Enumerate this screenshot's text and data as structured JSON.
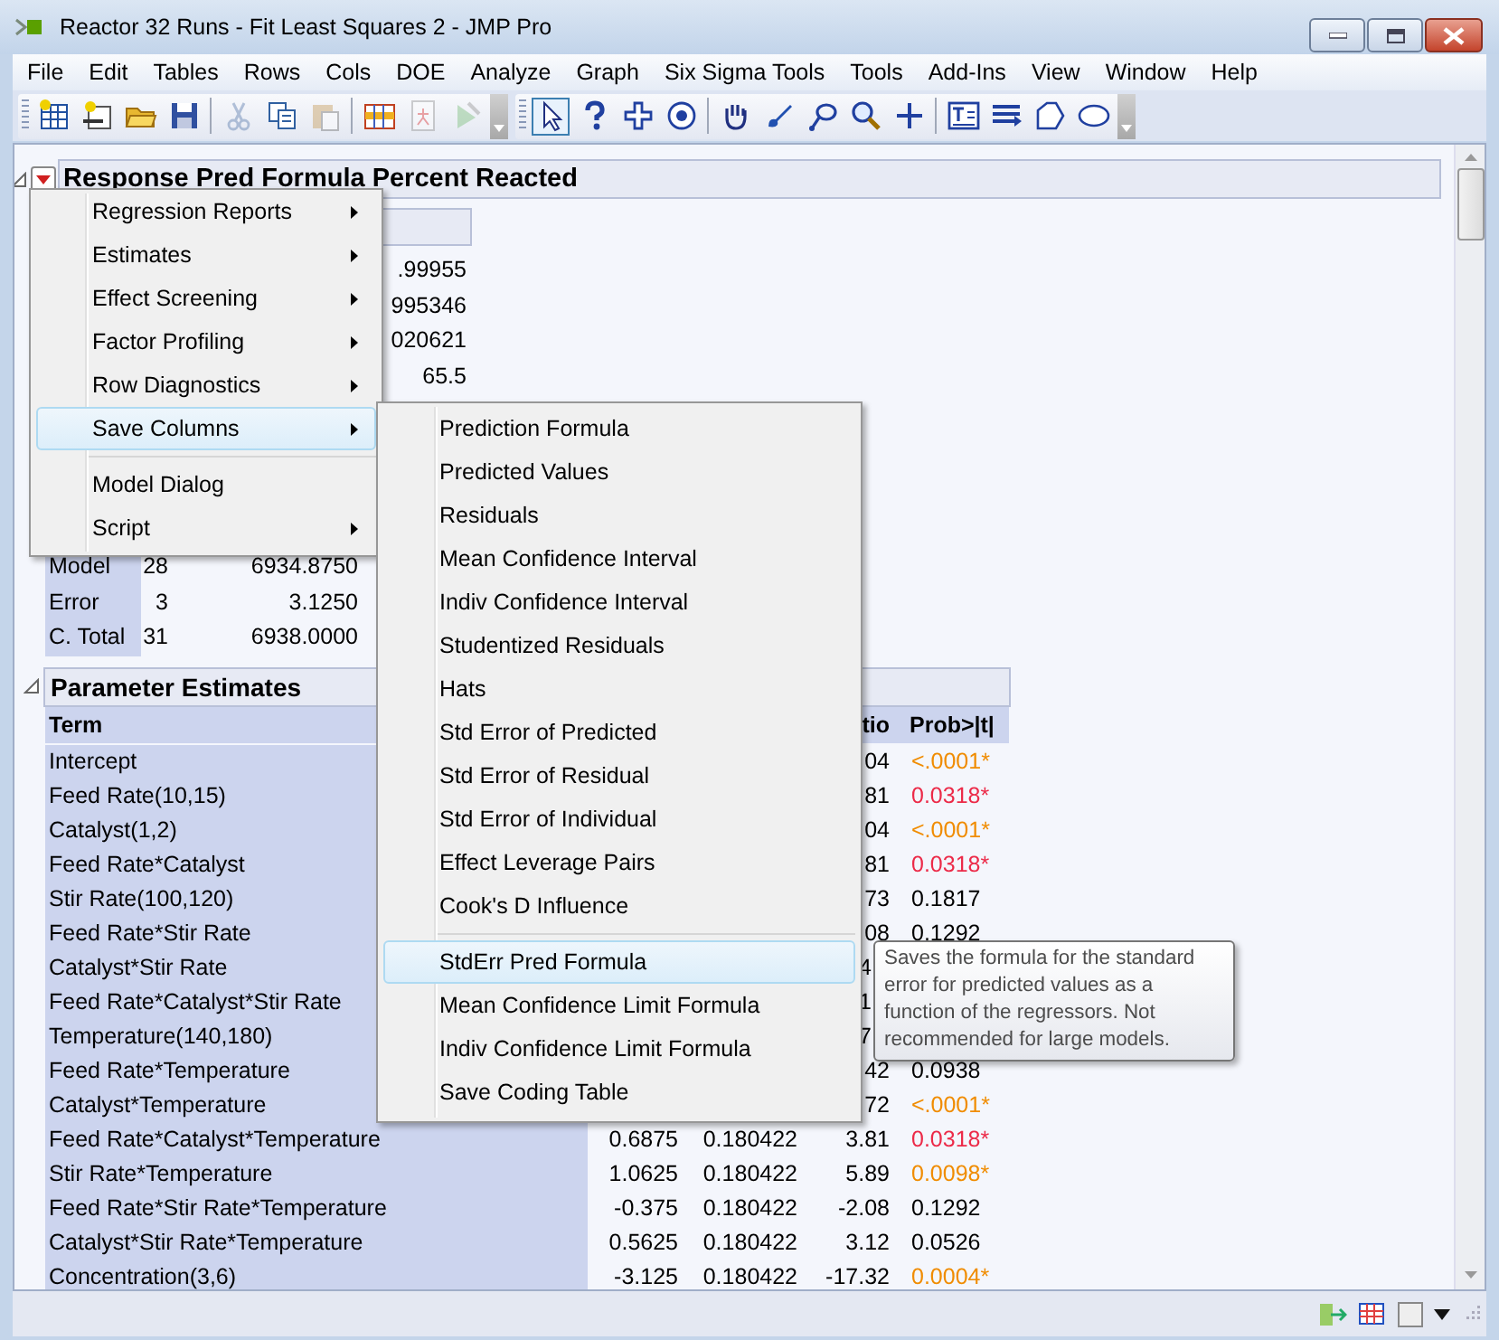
{
  "window": {
    "title": "Reactor 32 Runs - Fit Least Squares 2 - JMP Pro"
  },
  "menu_bar": [
    "File",
    "Edit",
    "Tables",
    "Rows",
    "Cols",
    "DOE",
    "Analyze",
    "Graph",
    "Six Sigma Tools",
    "Tools",
    "Add-Ins",
    "View",
    "Window",
    "Help"
  ],
  "report": {
    "title": "Response Pred Formula Percent Reacted",
    "summary_of_fit": {
      "values": [
        ".99955",
        "995346",
        "020621",
        "65.5"
      ]
    },
    "anova": {
      "rows": [
        {
          "source": "Model",
          "df": "28",
          "sum_of_squares": "6934.8750"
        },
        {
          "source": "Error",
          "df": "3",
          "sum_of_squares": "3.1250"
        },
        {
          "source": "C. Total",
          "df": "31",
          "sum_of_squares": "6938.0000"
        }
      ]
    },
    "parameter_estimates": {
      "title": "Parameter Estimates",
      "header": {
        "term": "Term",
        "column_4": "tio",
        "prob": "Prob>|t|"
      },
      "rows": [
        {
          "term": "Intercept",
          "column_4": "04",
          "prob": "<.0001*",
          "color": "#f08c00"
        },
        {
          "term": "Feed Rate(10,15)",
          "column_4": "81",
          "prob": "0.0318*",
          "color": "#ec2a48"
        },
        {
          "term": "Catalyst(1,2)",
          "column_4": "04",
          "prob": "<.0001*",
          "color": "#f08c00"
        },
        {
          "term": "Feed Rate*Catalyst",
          "column_4": "81",
          "prob": "0.0318*",
          "color": "#ec2a48"
        },
        {
          "term": "Stir Rate(100,120)",
          "column_4": "73",
          "prob": "0.1817",
          "color": "#000000"
        },
        {
          "term": "Feed Rate*Stir Rate",
          "column_4": "08",
          "prob": "0.1292",
          "color": "#000000"
        },
        {
          "term": "Catalyst*Stir Rate",
          "column_4": "4"
        },
        {
          "term": "Feed Rate*Catalyst*Stir Rate",
          "column_4": "1"
        },
        {
          "term": "Temperature(140,180)",
          "column_4": "7"
        },
        {
          "term": "Feed Rate*Temperature",
          "column_4": "42",
          "prob": "0.0938",
          "color": "#000000"
        },
        {
          "term": "Catalyst*Temperature",
          "column_4": "72",
          "prob": "<.0001*",
          "color": "#f08c00"
        },
        {
          "term": "Feed Rate*Catalyst*Temperature",
          "column_2": "0.6875",
          "column_3": "0.180422",
          "column_4": "3.81",
          "prob": "0.0318*",
          "color": "#ec2a48"
        },
        {
          "term": "Stir Rate*Temperature",
          "column_2": "1.0625",
          "column_3": "0.180422",
          "column_4": "5.89",
          "prob": "0.0098*",
          "color": "#f08c00"
        },
        {
          "term": "Feed Rate*Stir Rate*Temperature",
          "column_2": "-0.375",
          "column_3": "0.180422",
          "column_4": "-2.08",
          "prob": "0.1292",
          "color": "#000000"
        },
        {
          "term": "Catalyst*Stir Rate*Temperature",
          "column_2": "0.5625",
          "column_3": "0.180422",
          "column_4": "3.12",
          "prob": "0.0526",
          "color": "#000000"
        },
        {
          "term": "Concentration(3,6)",
          "column_2": "-3.125",
          "column_3": "0.180422",
          "column_4": "-17.32",
          "prob": "0.0004*",
          "color": "#f08c00"
        }
      ]
    }
  },
  "context_menu": {
    "items": [
      {
        "kind": "item",
        "label": "Regression Reports",
        "submenu": true,
        "selected": false
      },
      {
        "kind": "item",
        "label": "Estimates",
        "submenu": true,
        "selected": false
      },
      {
        "kind": "item",
        "label": "Effect Screening",
        "submenu": true,
        "selected": false
      },
      {
        "kind": "item",
        "label": "Factor Profiling",
        "submenu": true,
        "selected": false
      },
      {
        "kind": "item",
        "label": "Row Diagnostics",
        "submenu": true,
        "selected": false
      },
      {
        "kind": "item",
        "label": "Save Columns",
        "submenu": true,
        "selected": true
      },
      {
        "kind": "separator"
      },
      {
        "kind": "item",
        "label": "Model Dialog",
        "submenu": false,
        "selected": false
      },
      {
        "kind": "item",
        "label": "Script",
        "submenu": true,
        "selected": false
      }
    ]
  },
  "submenu": {
    "items": [
      {
        "kind": "item",
        "label": "Prediction Formula",
        "selected": false
      },
      {
        "kind": "item",
        "label": "Predicted Values",
        "selected": false
      },
      {
        "kind": "item",
        "label": "Residuals",
        "selected": false
      },
      {
        "kind": "item",
        "label": "Mean Confidence Interval",
        "selected": false
      },
      {
        "kind": "item",
        "label": "Indiv Confidence Interval",
        "selected": false
      },
      {
        "kind": "item",
        "label": "Studentized Residuals",
        "selected": false
      },
      {
        "kind": "item",
        "label": "Hats",
        "selected": false
      },
      {
        "kind": "item",
        "label": "Std Error of Predicted",
        "selected": false
      },
      {
        "kind": "item",
        "label": "Std Error of Residual",
        "selected": false
      },
      {
        "kind": "item",
        "label": "Std Error of Individual",
        "selected": false
      },
      {
        "kind": "item",
        "label": "Effect Leverage Pairs",
        "selected": false
      },
      {
        "kind": "item",
        "label": "Cook's D Influence",
        "selected": false
      },
      {
        "kind": "separator"
      },
      {
        "kind": "item",
        "label": "StdErr Pred Formula",
        "selected": true
      },
      {
        "kind": "item",
        "label": "Mean Confidence Limit Formula",
        "selected": false
      },
      {
        "kind": "item",
        "label": "Indiv Confidence Limit Formula",
        "selected": false
      },
      {
        "kind": "item",
        "label": "Save Coding Table",
        "selected": false
      }
    ]
  },
  "tooltip": {
    "text": "Saves the formula for the standard error for predicted values as a function of the regressors. Not recommended for large models."
  }
}
